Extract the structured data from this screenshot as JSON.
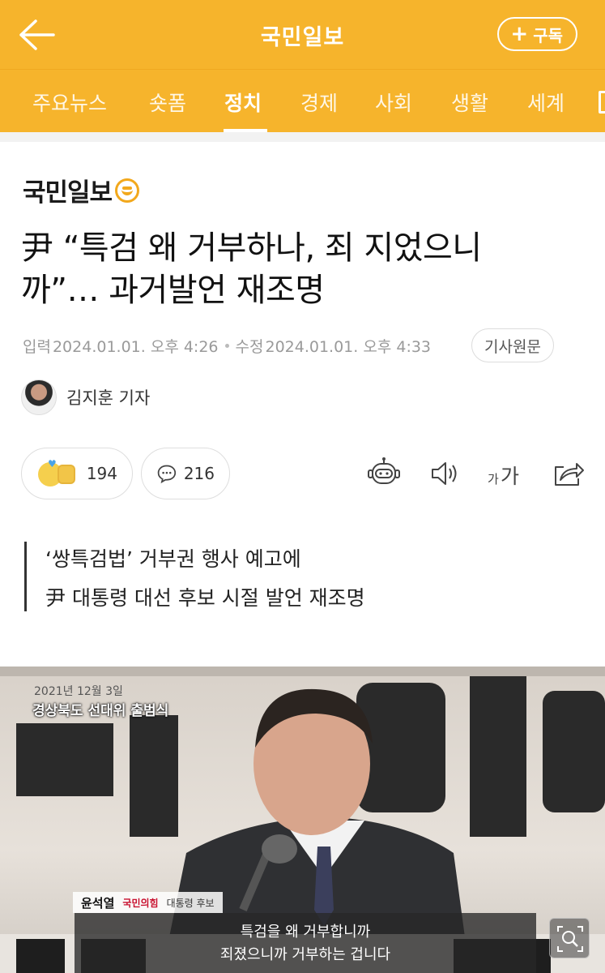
{
  "header": {
    "title": "국민일보",
    "subscribe_label": "구독",
    "background_color": "#f6b42c"
  },
  "nav": {
    "tabs": [
      "주요뉴스",
      "숏폼",
      "정치",
      "경제",
      "사회",
      "생활",
      "세계"
    ],
    "active_tab": "정치"
  },
  "article": {
    "publisher_logo": "국민일보",
    "headline_line1": "尹 “특검 왜 거부하나, 죄 지었으니",
    "headline_line2": "까”… 과거발언 재조명",
    "input_label": "입력",
    "input_time": "2024.01.01. 오후 4:26",
    "edit_label": "수정",
    "edit_time": "2024.01.01. 오후 4:33",
    "original_button": "기사원문",
    "author": "김지훈 기자",
    "reaction_count": "194",
    "comment_count": "216",
    "font_size_label_small": "가",
    "font_size_label_large": "가",
    "quote_line1": "‘쌍특검법’ 거부권 행사 예고에",
    "quote_line2": "尹 대통령 대선 후보 시절 발언 재조명"
  },
  "photo": {
    "caption_date": "2021년 12월 3일",
    "caption_event": "경상북도 선대위 출범식",
    "name_label": "윤석열",
    "party_label": "국민의힘",
    "role_label": "대통령 후보",
    "subtitle_line1": "특검을 왜 거부합니까",
    "subtitle_line2": "죄졌으니까 거부하는 겁니다"
  },
  "icons": {
    "back": "arrow-left-icon",
    "ai_summary": "robot-icon",
    "tts": "speaker-icon",
    "share": "share-icon",
    "zoom": "search-zoom-icon"
  }
}
